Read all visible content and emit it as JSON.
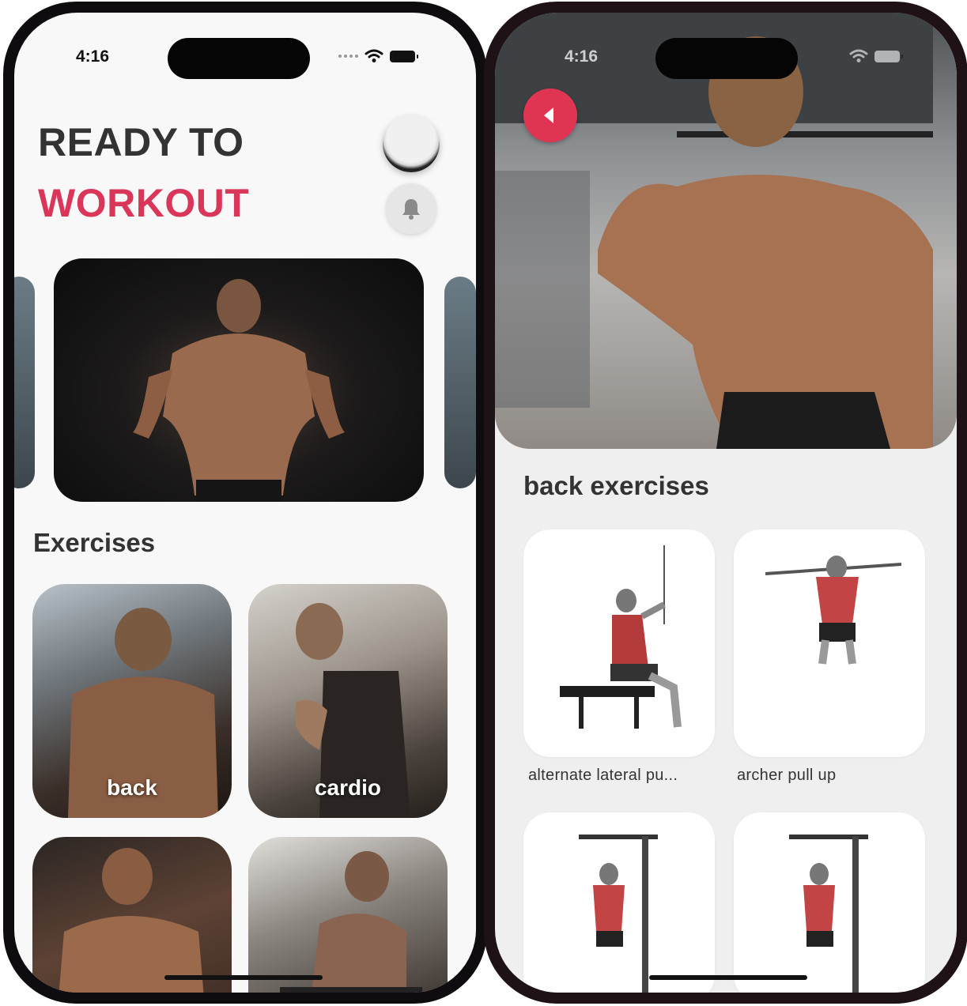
{
  "left_screen": {
    "status": {
      "time": "4:16"
    },
    "heading": {
      "line1": "READY TO",
      "line2": "WORKOUT"
    },
    "section_title": "Exercises",
    "categories": [
      {
        "label": "back"
      },
      {
        "label": "cardio"
      },
      {
        "label": ""
      },
      {
        "label": ""
      }
    ]
  },
  "right_screen": {
    "status": {
      "time": "4:16"
    },
    "section_title": "back exercises",
    "exercises": [
      {
        "name": "alternate lateral pu..."
      },
      {
        "name": "archer pull up"
      },
      {
        "name": ""
      },
      {
        "name": ""
      }
    ]
  },
  "colors": {
    "accent": "#d9365a",
    "back_button": "#e03453",
    "heading_dark": "#333333"
  },
  "icons": {
    "bell": "bell-icon",
    "back": "back-arrow-icon",
    "wifi": "wifi-icon",
    "battery": "battery-icon"
  }
}
